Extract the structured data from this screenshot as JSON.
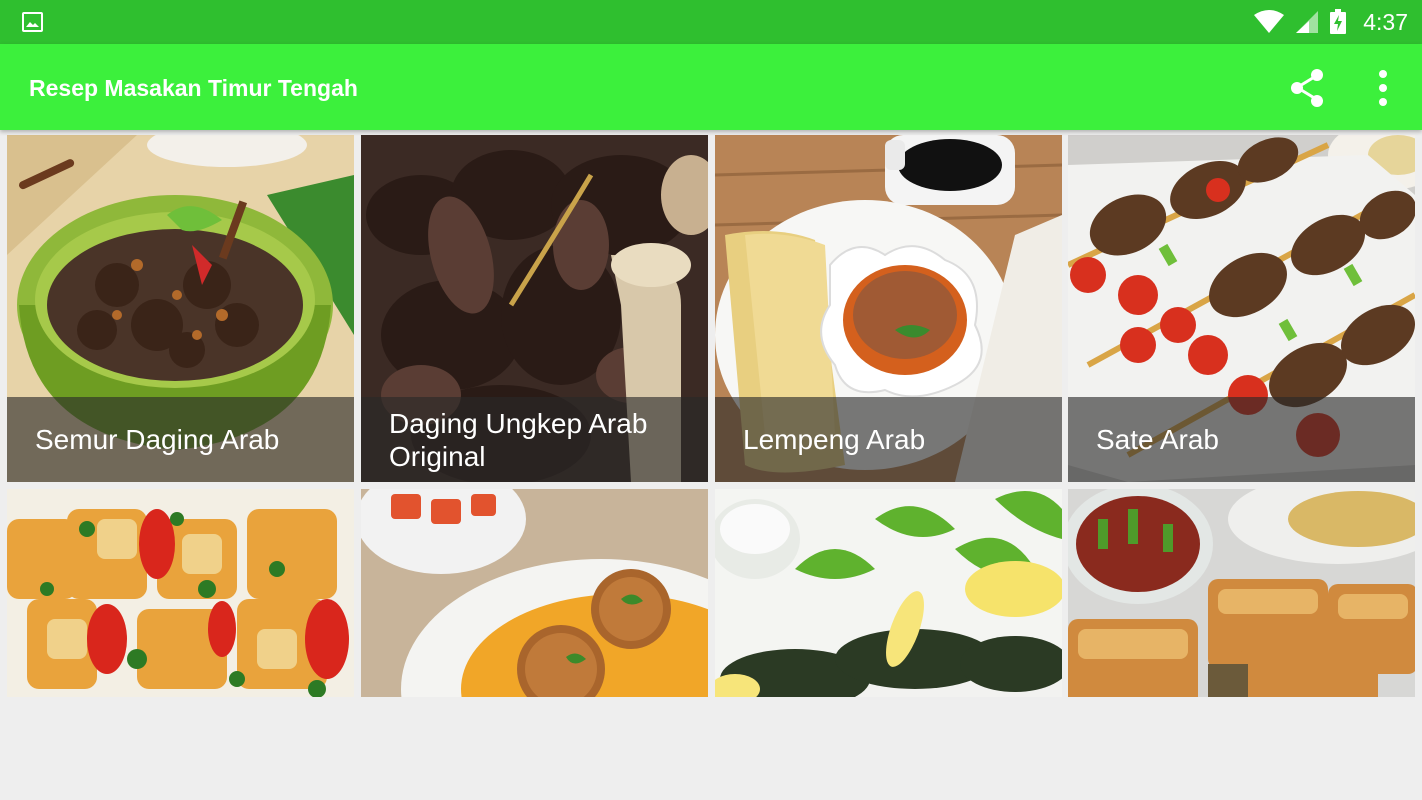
{
  "status_bar": {
    "time": "4:37",
    "icons": [
      "gallery-icon",
      "wifi-icon",
      "signal-icon",
      "battery-charging-icon"
    ]
  },
  "app_bar": {
    "title": "Resep Masakan Timur Tengah",
    "actions": [
      "share-icon",
      "more-vert-icon"
    ]
  },
  "recipes": [
    {
      "title": "Semur Daging Arab"
    },
    {
      "title": "Daging Ungkep Arab Original"
    },
    {
      "title": "Lempeng Arab"
    },
    {
      "title": "Sate Arab"
    },
    {
      "title": ""
    },
    {
      "title": ""
    },
    {
      "title": ""
    },
    {
      "title": ""
    }
  ],
  "colors": {
    "status_bar": "#2fbf2f",
    "app_bar": "#3cf03c",
    "background": "#eeeeee"
  }
}
